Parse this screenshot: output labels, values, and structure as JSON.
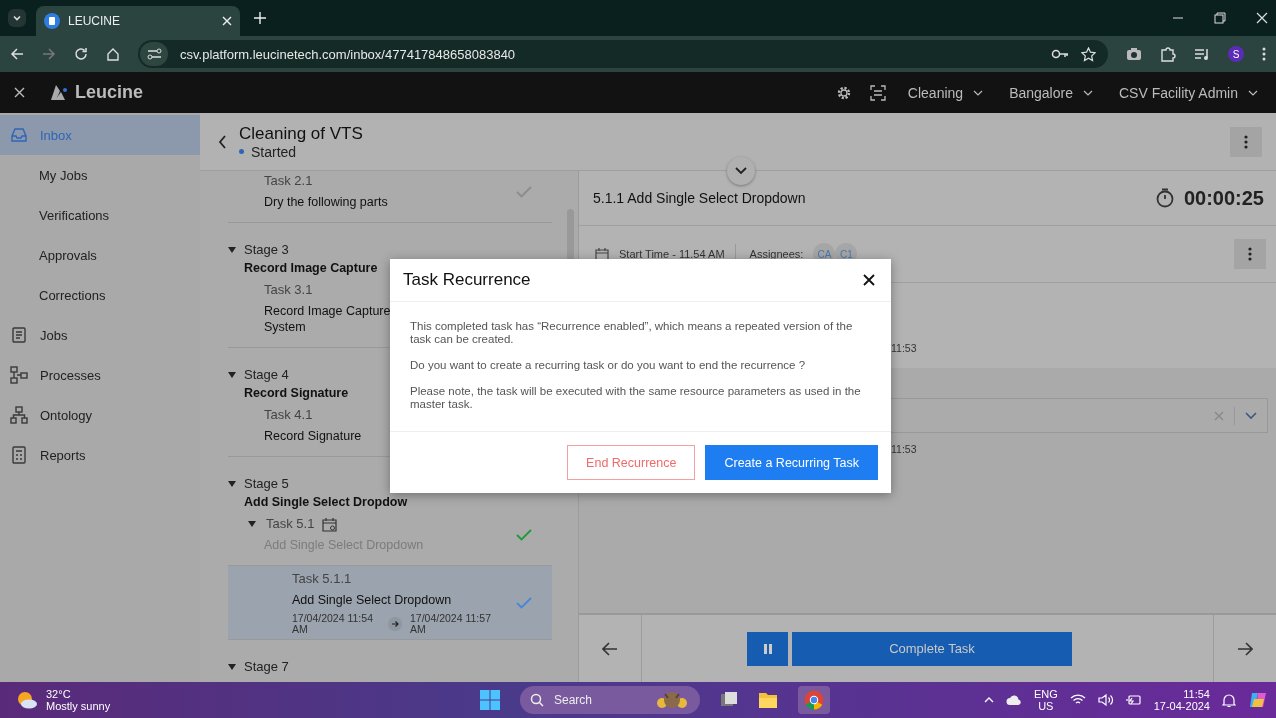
{
  "browser": {
    "tab_title": "LEUCINE",
    "url": "csv.platform.leucinetech.com/inbox/477417848658083840",
    "profile_initial": "S"
  },
  "app_header": {
    "brand": "Leucine",
    "menus": [
      {
        "label": "Cleaning"
      },
      {
        "label": "Bangalore"
      },
      {
        "label": "CSV Facility Admin"
      }
    ]
  },
  "sidebar": {
    "items": [
      {
        "label": "Inbox",
        "kind": "main",
        "selected": true
      },
      {
        "label": "My Jobs",
        "kind": "sub",
        "selected": false
      },
      {
        "label": "Verifications",
        "kind": "sub",
        "selected": false
      },
      {
        "label": "Approvals",
        "kind": "sub",
        "selected": false
      },
      {
        "label": "Corrections",
        "kind": "sub",
        "selected": false
      },
      {
        "label": "Jobs",
        "kind": "main",
        "selected": false
      },
      {
        "label": "Processes",
        "kind": "main",
        "selected": false
      },
      {
        "label": "Ontology",
        "kind": "main",
        "selected": false
      },
      {
        "label": "Reports",
        "kind": "main",
        "selected": false
      }
    ]
  },
  "job": {
    "title": "Cleaning of VTS",
    "status": "Started"
  },
  "task_list": [
    {
      "tasks": [
        {
          "number": "Task 2.1",
          "name_lines": [
            "Dry the following parts"
          ],
          "color": "#8c8c8c",
          "selected": false
        }
      ]
    },
    {
      "label": "Stage 3",
      "name": "Record Image Capture",
      "expanded": true,
      "tasks": [
        {
          "number": "Task 3.1",
          "name_lines": [
            "Record Image Capture",
            "System"
          ],
          "selected": false
        }
      ]
    },
    {
      "label": "Stage 4",
      "name": "Record Signature",
      "expanded": true,
      "tasks": [
        {
          "number": "Task 4.1",
          "name_lines": [
            "Record Signature"
          ],
          "selected": false
        }
      ]
    },
    {
      "label": "Stage 5",
      "name": "Add Single Select Dropdow",
      "expanded": true,
      "tasks": [
        {
          "number": "Task 5.1",
          "name_lines": [
            "Add Single Select Dropdown"
          ],
          "muted": true,
          "recurring": true,
          "expanded": true,
          "color": "#1f9a3c",
          "selected": false,
          "children": [
            {
              "number": "Task 5.1.1",
              "name_lines": [
                "Add Single Select Dropdown"
              ],
              "start": "17/04/2024 11:54 AM",
              "end": "17/04/2024 11:57 AM",
              "color": "#4a86d8",
              "selected": true
            }
          ]
        }
      ]
    },
    {
      "label": "Stage 7",
      "expanded": true
    }
  ],
  "task_panel": {
    "title": "5.1.1 Add Single Select Dropdown",
    "timer": "00:00:25",
    "start_time": "Start Time - 11.54 AM",
    "assignees_label": "Assignees:",
    "assignees": [
      "CA",
      "C1"
    ],
    "activity_times": [
      "11:53",
      "11:53"
    ],
    "complete_button": "Complete Task"
  },
  "modal": {
    "title": "Task Recurrence",
    "paragraphs": [
      "This completed task has “Recurrence enabled”, which means a repeated version of the task can be created.",
      "Do you want to create a recurring task or do you want to end the recurrence ?",
      "Please note, the task will be executed with the same resource parameters as used in the master task."
    ],
    "buttons": [
      {
        "label": "End Recurrence",
        "kind": "secondary"
      },
      {
        "label": "Create a Recurring Task",
        "kind": "primary"
      }
    ]
  },
  "taskbar": {
    "temperature": "32°C",
    "weather": "Mostly sunny",
    "search_placeholder": "Search",
    "language": [
      "ENG",
      "US"
    ],
    "time": "11:54",
    "date": "17-04-2024"
  }
}
